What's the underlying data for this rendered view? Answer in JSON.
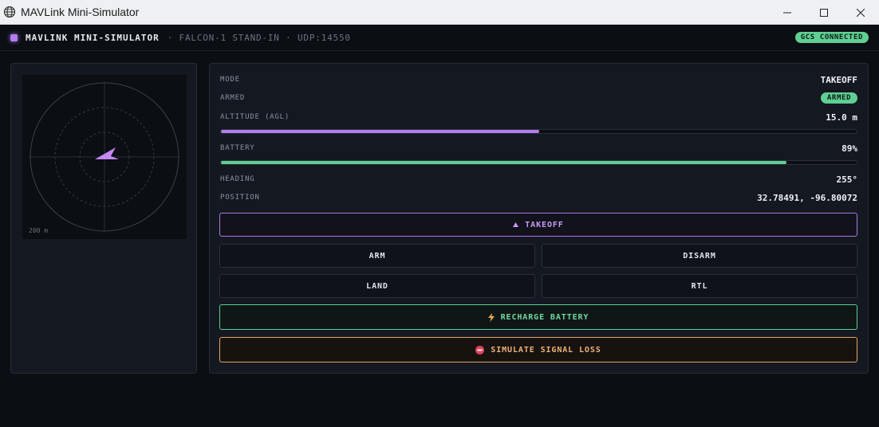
{
  "window": {
    "title": "MAVLink Mini-Simulator"
  },
  "header": {
    "brand": "MAVLINK MINI-SIMULATOR",
    "subtitle": "· FALCON-1 STAND-IN · UDP:14550",
    "gcs_status": "GCS CONNECTED"
  },
  "radar": {
    "scale_label": "200 m",
    "heading_deg": 255
  },
  "telemetry": {
    "mode_label": "MODE",
    "mode_value": "TAKEOFF",
    "armed_label": "ARMED",
    "armed_value": "ARMED",
    "altitude_label": "ALTITUDE (AGL)",
    "altitude_value": "15.0 m",
    "altitude_fraction": 0.5,
    "battery_label": "BATTERY",
    "battery_value": "89%",
    "battery_fraction": 0.89,
    "heading_label": "HEADING",
    "heading_value": "255°",
    "position_label": "POSITION",
    "position_value": "32.78491, -96.80072"
  },
  "buttons": {
    "takeoff": "TAKEOFF",
    "arm": "ARM",
    "disarm": "DISARM",
    "land": "LAND",
    "rtl": "RTL",
    "recharge": "RECHARGE BATTERY",
    "signal_loss": "SIMULATE SIGNAL LOSS"
  },
  "colors": {
    "accent_purple": "#b47cf0",
    "accent_green": "#5fcf93",
    "accent_orange": "#e9a366",
    "danger_red": "#e0435a"
  }
}
